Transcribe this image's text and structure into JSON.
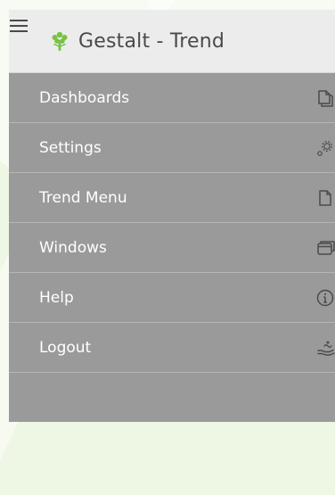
{
  "app": {
    "title": "Gestalt - Trend",
    "logo_icon": "tree-logo-icon",
    "menu_toggle_icon": "hamburger-icon"
  },
  "colors": {
    "header_bg": "#ececec",
    "nav_bg": "#9a9a9a",
    "nav_divider": "#b6b6b6",
    "nav_text": "#ffffff",
    "icon_color": "#4a4a4a",
    "logo_green": "#79c143"
  },
  "nav": {
    "items": [
      {
        "label": "Dashboards",
        "icon": "copy-pages-icon"
      },
      {
        "label": "Settings",
        "icon": "gears-icon"
      },
      {
        "label": "Trend Menu",
        "icon": "document-icon"
      },
      {
        "label": "Windows",
        "icon": "windows-stack-icon"
      },
      {
        "label": "Help",
        "icon": "info-circle-icon"
      },
      {
        "label": "Logout",
        "icon": "hand-logout-icon"
      }
    ]
  }
}
